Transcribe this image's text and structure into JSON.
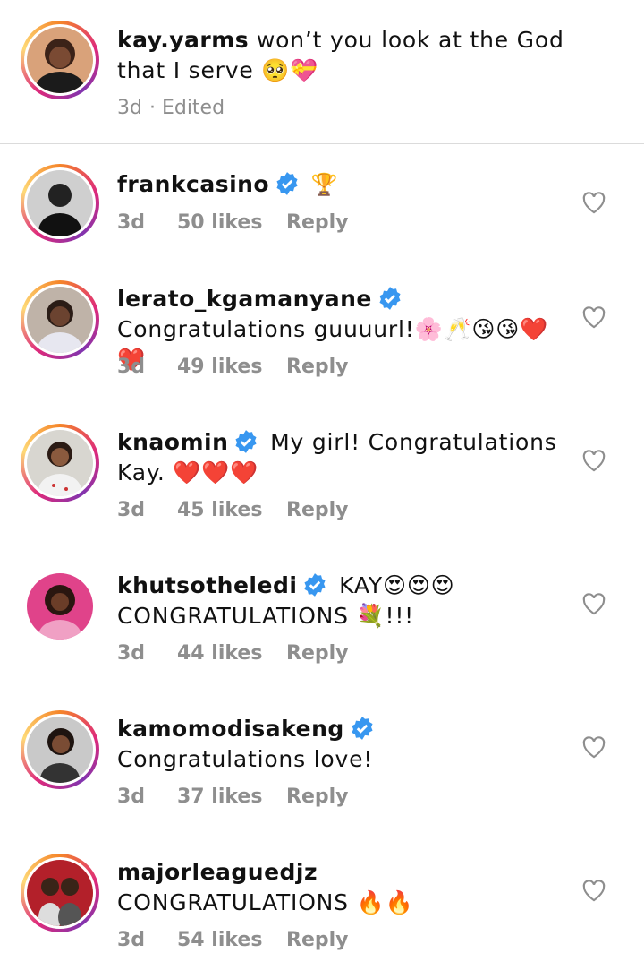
{
  "caption": {
    "username": "kay.yarms",
    "text": " won’t you look at the God that I serve 🥺💝",
    "time": "3d",
    "edited": "· Edited"
  },
  "comments": [
    {
      "username": "frankcasino",
      "verified": true,
      "text": " 🏆",
      "time": "3d",
      "likes": "50 likes",
      "reply": "Reply"
    },
    {
      "username": "lerato_kgamanyane",
      "verified": true,
      "text": " Congratulations guuuurl!🌸🥂😘😘❤️❤️",
      "time": "3d",
      "likes": "49 likes",
      "reply": "Reply"
    },
    {
      "username": "knaomin",
      "verified": true,
      "text": " My girl! Congratulations Kay. ❤️❤️❤️",
      "time": "3d",
      "likes": "45 likes",
      "reply": "Reply"
    },
    {
      "username": "khutsotheledi",
      "verified": true,
      "text": " KAY😍😍😍 CONGRATULATIONS 💐!!!",
      "time": "3d",
      "likes": "44 likes",
      "reply": "Reply"
    },
    {
      "username": "kamomodisakeng",
      "verified": true,
      "text": " Congratulations love!",
      "time": "3d",
      "likes": "37 likes",
      "reply": "Reply"
    },
    {
      "username": "majorleaguedjz",
      "verified": false,
      "text": " CONGRATULATIONS 🔥🔥",
      "time": "3d",
      "likes": "54 likes",
      "reply": "Reply"
    }
  ],
  "icons": {
    "verified": "verified-badge-icon",
    "like": "heart-outline-icon"
  },
  "colors": {
    "verified_blue": "#3897f0",
    "meta_gray": "#8e8e8e",
    "divider": "#dbdbdb"
  }
}
